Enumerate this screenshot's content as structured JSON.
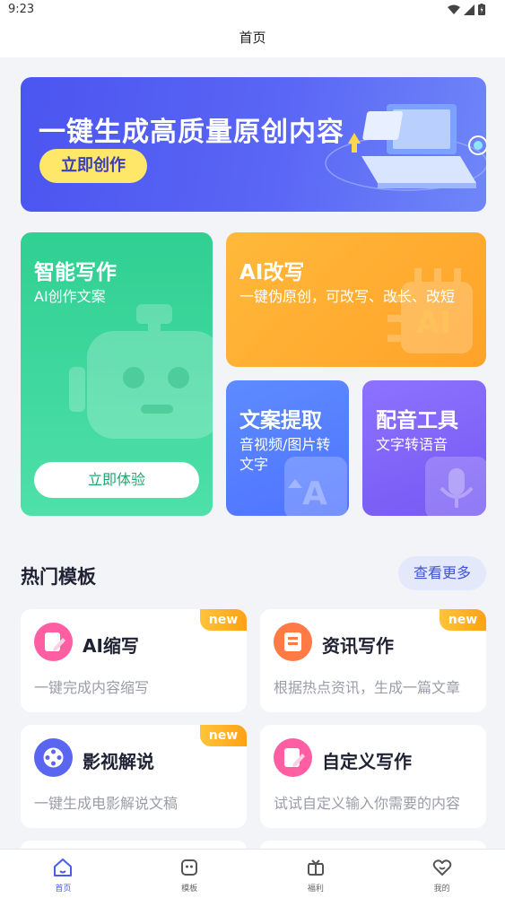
{
  "status": {
    "time": "9:23"
  },
  "header": {
    "title": "首页"
  },
  "banner": {
    "title": "一键生成高质量原创内容",
    "button": "立即创作"
  },
  "features": {
    "write": {
      "title": "智能写作",
      "desc": "AI创作文案",
      "button": "立即体验"
    },
    "rewrite": {
      "title": "AI改写",
      "desc": "一键伪原创，可改写、改长、改短"
    },
    "extract": {
      "title": "文案提取",
      "desc": "音视频/图片转文字"
    },
    "voice": {
      "title": "配音工具",
      "desc": "文字转语音"
    }
  },
  "hot": {
    "title": "热门模板",
    "more": "查看更多",
    "items": [
      {
        "name": "AI缩写",
        "desc": "一键完成内容缩写",
        "badge": "new",
        "icon": "edit-icon",
        "color": "#ff5fa2"
      },
      {
        "name": "资讯写作",
        "desc": "根据热点资讯，生成一篇文章",
        "badge": "new",
        "icon": "document-icon",
        "color": "#ff7a45"
      },
      {
        "name": "影视解说",
        "desc": "一键生成电影解说文稿",
        "badge": "new",
        "icon": "film-reel-icon",
        "color": "#5a66f0"
      },
      {
        "name": "自定义写作",
        "desc": "试试自定义输入你需要的内容",
        "badge": "",
        "icon": "edit-icon",
        "color": "#ff5fa2"
      }
    ]
  },
  "tabs": [
    {
      "label": "首页",
      "icon": "home-icon",
      "active": true
    },
    {
      "label": "模板",
      "icon": "template-icon",
      "active": false
    },
    {
      "label": "福利",
      "icon": "gift-icon",
      "active": false
    },
    {
      "label": "我的",
      "icon": "heart-face-icon",
      "active": false
    }
  ],
  "colors": {
    "accent": "#4a5cf0",
    "green": "#30cf92",
    "orange": "#ffa22a",
    "blue": "#4f73ff",
    "purple": "#7559f3"
  }
}
